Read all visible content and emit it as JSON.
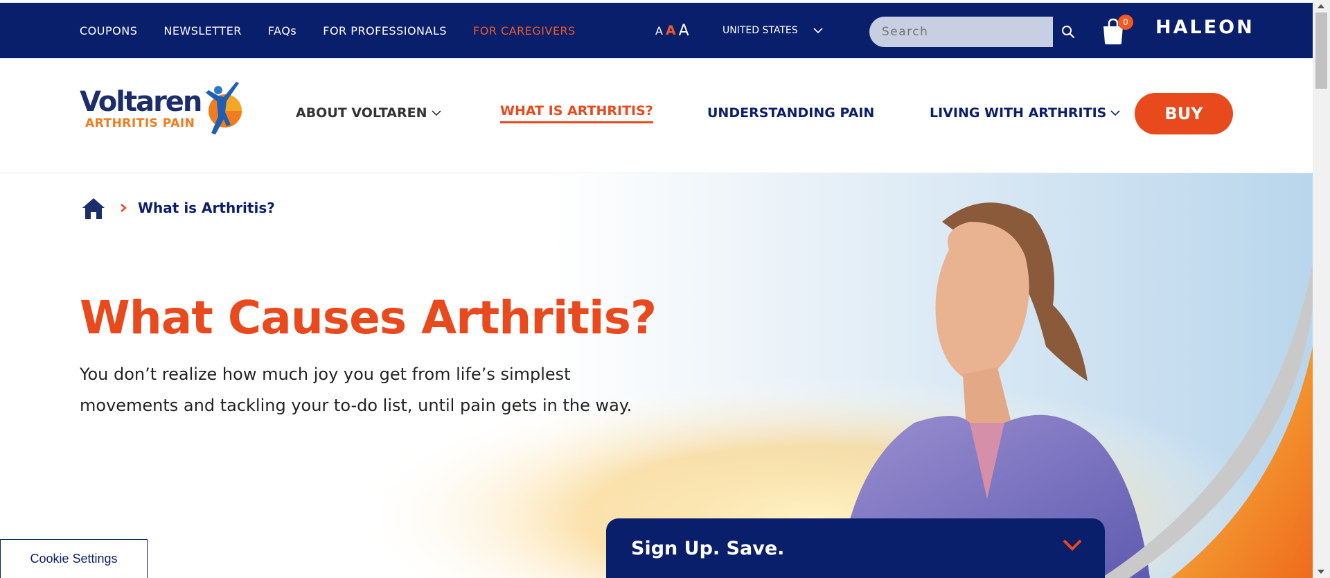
{
  "topbar": {
    "links": [
      {
        "label": "COUPONS"
      },
      {
        "label": "NEWSLETTER"
      },
      {
        "label": "FAQs"
      },
      {
        "label": "FOR PROFESSIONALS"
      },
      {
        "label": "FOR CAREGIVERS"
      }
    ],
    "text_size": [
      "A",
      "A",
      "A"
    ],
    "country": "UNITED STATES",
    "search_placeholder": "Search",
    "cart_count": "0",
    "brand": "HALEON"
  },
  "header": {
    "logo_brand": "Voltaren",
    "logo_sub": "ARTHRITIS PAIN",
    "nav": [
      {
        "label": "ABOUT VOLTAREN"
      },
      {
        "label": "WHAT IS ARTHRITIS?"
      },
      {
        "label": "UNDERSTANDING PAIN"
      },
      {
        "label": "LIVING WITH ARTHRITIS"
      }
    ],
    "buy_label": "BUY"
  },
  "breadcrumb": {
    "current": "What is Arthritis?"
  },
  "hero": {
    "title": "What Causes Arthritis?",
    "lead": "You don’t realize how much joy you get from life’s simplest movements and tackling your to-do list, until pain gets in the way."
  },
  "cookie_label": "Cookie Settings",
  "signup_label": "Sign Up. Save.",
  "colors": {
    "navy": "#0a1f6b",
    "orange": "#e8491d",
    "caregivers": "#f05a22"
  }
}
